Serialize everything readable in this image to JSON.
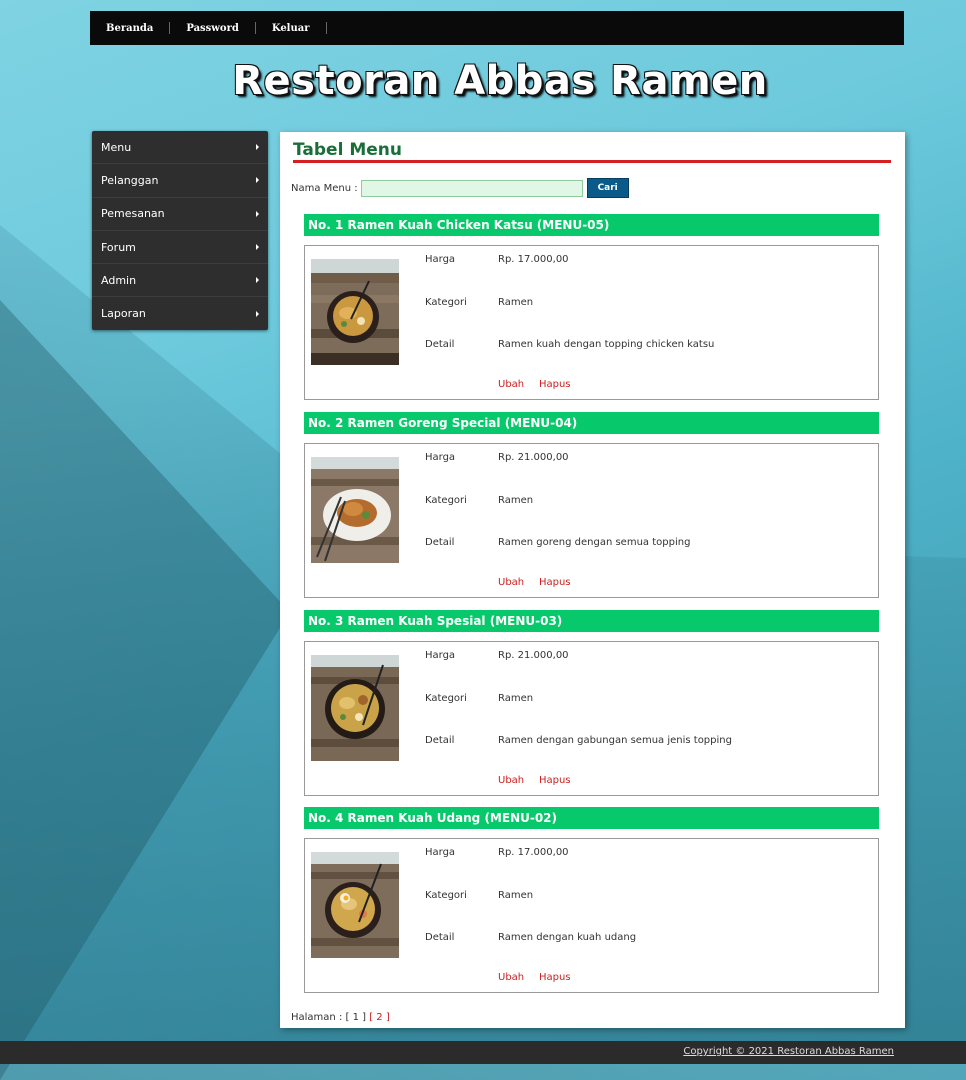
{
  "nav": {
    "items": [
      "Beranda",
      "Password",
      "Keluar"
    ]
  },
  "site_title": "Restoran Abbas Ramen",
  "sidebar": {
    "items": [
      {
        "label": "Menu"
      },
      {
        "label": "Pelanggan"
      },
      {
        "label": "Pemesanan"
      },
      {
        "label": "Forum"
      },
      {
        "label": "Admin"
      },
      {
        "label": "Laporan"
      }
    ]
  },
  "main": {
    "title": "Tabel Menu",
    "search_label": "Nama Menu :",
    "search_value": "",
    "search_button": "Cari",
    "field_labels": {
      "harga": "Harga",
      "kategori": "Kategori",
      "detail": "Detail"
    },
    "action_edit": "Ubah",
    "action_delete": "Hapus",
    "cards": [
      {
        "heading": "No. 1 Ramen Kuah Chicken Katsu (MENU-05)",
        "harga": "Rp. 17.000,00",
        "kategori": "Ramen",
        "detail": "Ramen kuah dengan topping chicken katsu"
      },
      {
        "heading": "No. 2 Ramen Goreng Special (MENU-04)",
        "harga": "Rp. 21.000,00",
        "kategori": "Ramen",
        "detail": "Ramen goreng dengan semua topping"
      },
      {
        "heading": "No. 3 Ramen Kuah Spesial (MENU-03)",
        "harga": "Rp. 21.000,00",
        "kategori": "Ramen",
        "detail": "Ramen dengan gabungan semua jenis topping"
      },
      {
        "heading": "No. 4 Ramen Kuah Udang (MENU-02)",
        "harga": "Rp. 17.000,00",
        "kategori": "Ramen",
        "detail": "Ramen dengan kuah udang"
      }
    ],
    "pager": {
      "label": "Halaman :",
      "pages": [
        "[ 1 ]",
        "[ 2 ]"
      ]
    }
  },
  "footer": {
    "copyright": "Copyright © 2021 Restoran Abbas Ramen"
  },
  "colors": {
    "accent_green": "#07c96b",
    "title_green": "#1a6e3a",
    "rule_red": "#d42020",
    "link_red": "#cc1f1f"
  }
}
